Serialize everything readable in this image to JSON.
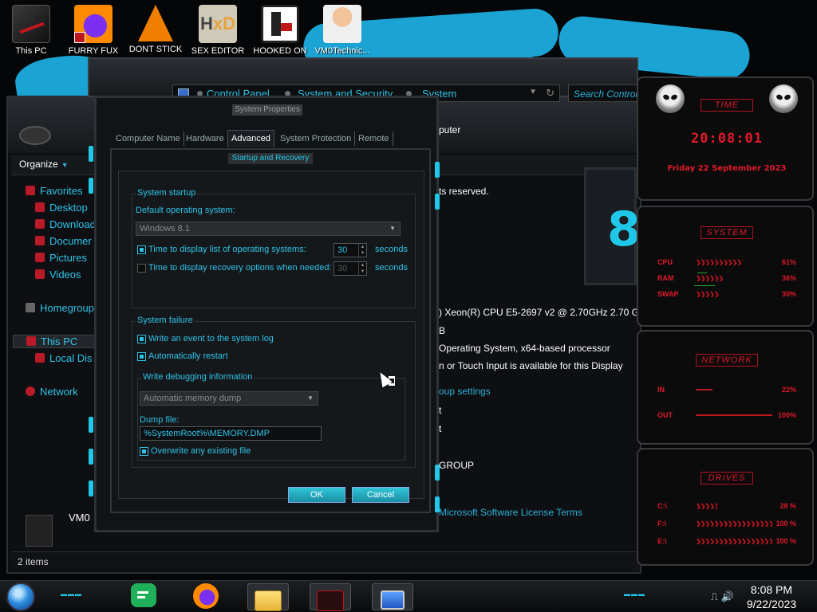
{
  "desktop": {
    "icons": [
      {
        "label": "This PC",
        "icon": "computer-icon"
      },
      {
        "label": "FURRY FUX",
        "icon": "firefox-icon"
      },
      {
        "label": "DONT STICK",
        "icon": "vlc-cone-icon"
      },
      {
        "label": "SEX EDITOR",
        "icon": "hxd-icon"
      },
      {
        "label": "HOOKED ON",
        "icon": "hooked-icon"
      },
      {
        "label": "VM0Technic...",
        "icon": "doctor-icon"
      }
    ]
  },
  "explorer": {
    "organize_label": "Organize",
    "nav": {
      "favorites": "Favorites",
      "desktop": "Desktop",
      "downloads": "Download",
      "documents": "Documer",
      "pictures": "Pictures",
      "videos": "Videos",
      "homegroup": "Homegroup",
      "this_pc": "This PC",
      "local_disk": "Local Dis",
      "network": "Network"
    },
    "content": {
      "computer_text": "puter",
      "rights_text": "ts reserved.",
      "cpu_text": ") Xeon(R) CPU E5-2697 v2 @ 2.70GHz   2.70 G",
      "ram_text": "B",
      "os_type_text": "Operating System, x64-based processor",
      "pen_text": "n or Touch Input is available for this Display",
      "workgroup_settings": "oup settings",
      "t1": "t",
      "t2": "t",
      "workgroup": "GROUP",
      "license": "Microsoft Software License Terms"
    },
    "big_digit": "8",
    "vm_label": "VM0",
    "items_count": "2 items"
  },
  "address": {
    "crumbs": [
      "Control Panel",
      "System and Security",
      "System"
    ],
    "search_placeholder": "Search Control..."
  },
  "system_properties": {
    "title": "System Properties",
    "tabs": [
      "Computer Name",
      "Hardware",
      "Advanced",
      "System Protection",
      "Remote"
    ],
    "active_tab": "Advanced"
  },
  "startup_recovery": {
    "title": "Startup and Recovery",
    "system_startup": {
      "group_title": "System startup",
      "default_os_label": "Default operating system:",
      "default_os_value": "Windows 8.1",
      "display_list_label": "Time to display list of operating systems:",
      "display_list_value": "30",
      "display_list_checked": true,
      "recovery_label": "Time to display recovery options when needed:",
      "recovery_value": "30",
      "recovery_checked": false,
      "seconds_1": "seconds",
      "seconds_2": "seconds"
    },
    "system_failure": {
      "group_title": "System failure",
      "write_event": "Write an event to the system log",
      "write_event_checked": true,
      "auto_restart": "Automatically restart",
      "auto_restart_checked": true,
      "debug_title": "Write debugging information",
      "debug_value": "Automatic memory dump",
      "dump_file_label": "Dump file:",
      "dump_file_value": "%SystemRoot%\\MEMORY.DMP",
      "overwrite": "Overwrite any existing file",
      "overwrite_checked": true
    },
    "ok_label": "OK",
    "cancel_label": "Cancel"
  },
  "gadgets": {
    "time": {
      "title": "TIME",
      "clock": "20:08:01",
      "date": "Friday 22 September 2023"
    },
    "system": {
      "title": "SYSTEM",
      "rows": [
        {
          "name": "CPU",
          "value": "61%",
          "level": 0.61
        },
        {
          "name": "RAM",
          "value": "36%",
          "level": 0.36
        },
        {
          "name": "SWAP",
          "value": "30%",
          "level": 0.3
        }
      ]
    },
    "network": {
      "title": "NETWORK",
      "rows": [
        {
          "name": "IN",
          "value": "22%",
          "level": 0.22
        },
        {
          "name": "OUT",
          "value": "100%",
          "level": 1.0
        }
      ]
    },
    "drives": {
      "title": "DRIVES",
      "rows": [
        {
          "name": "C:\\",
          "value": "28 %",
          "level": 0.28
        },
        {
          "name": "F:\\",
          "value": "100 %",
          "level": 1.0
        },
        {
          "name": "E:\\",
          "value": "100 %",
          "level": 1.0
        }
      ]
    }
  },
  "taskbar": {
    "time": "8:08 PM",
    "date": "9/22/2023",
    "apps": [
      "notes-app",
      "firefox",
      "file-explorer",
      "red-app",
      "system-app"
    ]
  },
  "colors": {
    "accent_cyan": "#1fc8e8",
    "accent_red": "#e01a28",
    "wallpaper_blue": "#1ba3d4"
  }
}
